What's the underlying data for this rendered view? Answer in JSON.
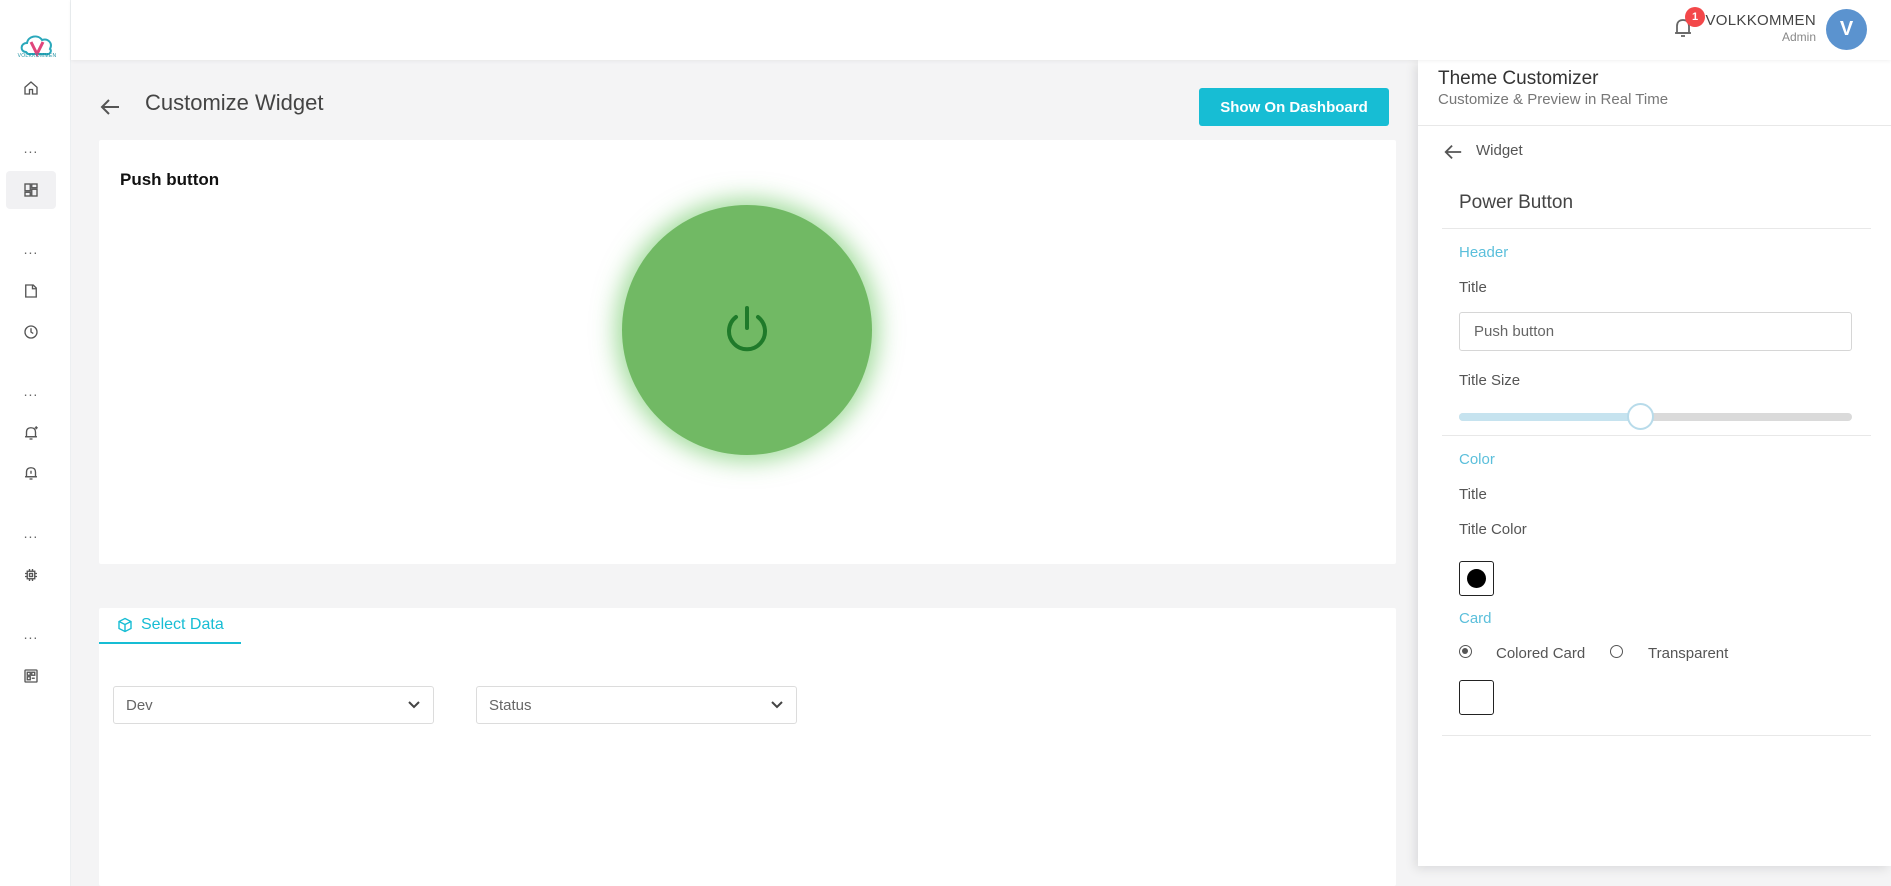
{
  "sidebar": {
    "logo_text": "VOLKKOMMEN",
    "items": [
      {
        "icon": "home-icon"
      },
      {
        "icon": "dashboard-icon"
      },
      {
        "icon": "report-icon"
      },
      {
        "icon": "clock-icon"
      },
      {
        "icon": "add-alert-icon"
      },
      {
        "icon": "alarm-icon"
      },
      {
        "icon": "chip-icon"
      },
      {
        "icon": "grid-settings-icon"
      }
    ],
    "dots": "..."
  },
  "topbar": {
    "notification_count": "1",
    "user_name": "VOLKKOMMEN",
    "user_role": "Admin",
    "avatar_initial": "V"
  },
  "page": {
    "title": "Customize Widget",
    "show_button_label": "Show On Dashboard"
  },
  "widget": {
    "title": "Push button",
    "state_color": "#71b964",
    "icon": "power-icon"
  },
  "data_panel": {
    "tab_label": "Select Data",
    "device_select": "Dev",
    "field_select": "Status"
  },
  "customizer": {
    "title": "Theme Customizer",
    "subtitle": "Customize & Preview in Real Time",
    "breadcrumb": "Widget",
    "section_title": "Power Button",
    "header_heading": "Header",
    "title_label": "Title",
    "title_value": "Push button",
    "title_size_label": "Title Size",
    "title_size_percent": 46,
    "color_heading": "Color",
    "color_title_label": "Title",
    "title_color_label": "Title Color",
    "title_color": "#000000",
    "card_heading": "Card",
    "card_options": [
      "Colored Card",
      "Transparent"
    ],
    "card_selected": "Colored Card",
    "accent_color": "#17bdd4"
  }
}
